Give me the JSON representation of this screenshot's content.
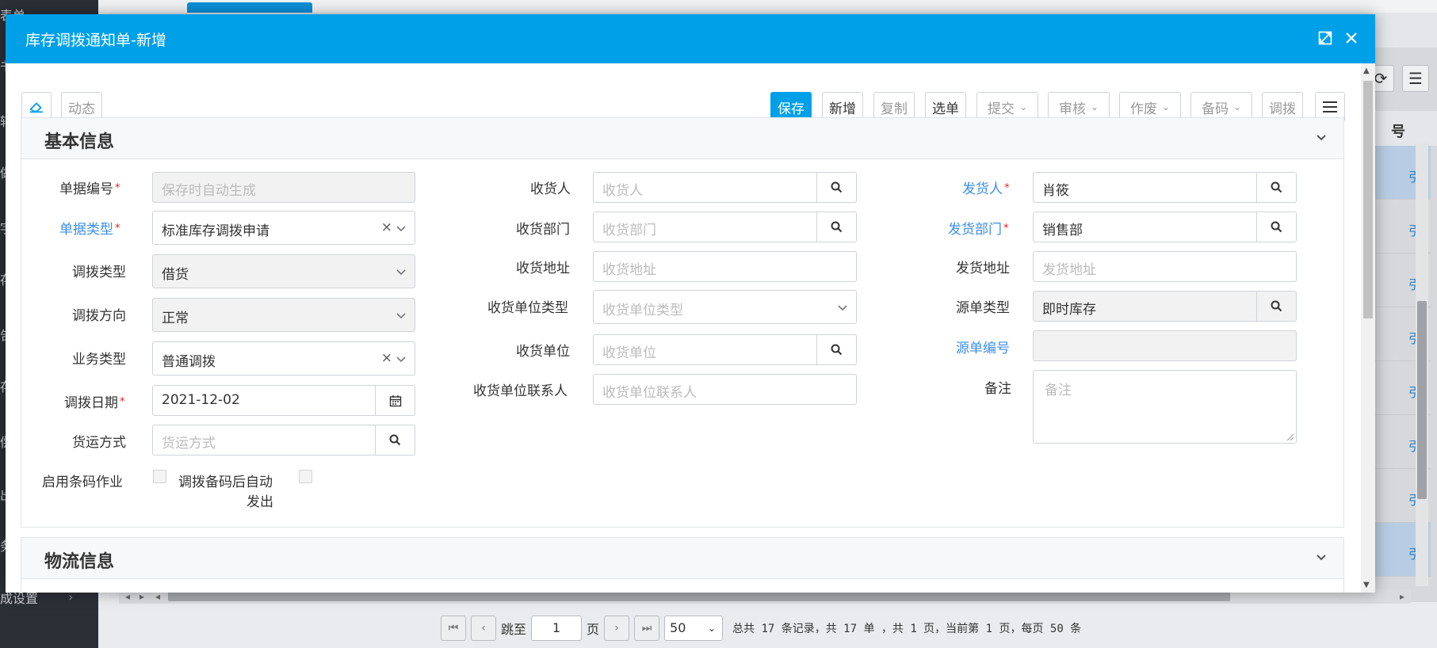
{
  "background": {
    "left_fragments": [
      "表单",
      "书",
      "辅",
      "做",
      "字",
      "存",
      "告",
      "存",
      "偿",
      "出",
      "务"
    ],
    "left_bottom_text": "成设置",
    "right_header": "号",
    "right_row_text": "引",
    "pager": {
      "jump_label": "跳至",
      "page_value": "1",
      "page_unit": "页",
      "page_size": "50",
      "summary": "总共 17 条记录，共 17 单 ，共 1 页，当前第 1 页，每页 50 条"
    }
  },
  "modal": {
    "title": "库存调拨通知单-新增",
    "toolbar": {
      "dynamic": "动态",
      "save": "保存",
      "add": "新增",
      "copy": "复制",
      "select_doc": "选单",
      "submit": "提交",
      "audit": "审核",
      "void": "作废",
      "code": "备码",
      "transfer": "调拨"
    },
    "basic_section": {
      "title": "基本信息",
      "col1": {
        "doc_no_label": "单据编号",
        "doc_no_placeholder": "保存时自动生成",
        "doc_type_label": "单据类型",
        "doc_type_value": "标准库存调拨申请",
        "transfer_type_label": "调拨类型",
        "transfer_type_value": "借货",
        "direction_label": "调拨方向",
        "direction_value": "正常",
        "biz_type_label": "业务类型",
        "biz_type_value": "普通调拨",
        "date_label": "调拨日期",
        "date_value": "2021-12-02",
        "ship_method_label": "货运方式",
        "ship_method_placeholder": "货运方式",
        "barcode_label": "启用条码作业",
        "auto_ship_label_line1": "调拨备码后自动",
        "auto_ship_label_line2": "发出"
      },
      "col2": {
        "receiver_label": "收货人",
        "receiver_placeholder": "收货人",
        "recv_dept_label": "收货部门",
        "recv_dept_placeholder": "收货部门",
        "recv_addr_label": "收货地址",
        "recv_addr_placeholder": "收货地址",
        "recv_unit_type_label": "收货单位类型",
        "recv_unit_type_placeholder": "收货单位类型",
        "recv_unit_label": "收货单位",
        "recv_unit_placeholder": "收货单位",
        "recv_contact_label": "收货单位联系人",
        "recv_contact_placeholder": "收货单位联系人"
      },
      "col3": {
        "shipper_label": "发货人",
        "shipper_value": "肖筱",
        "ship_dept_label": "发货部门",
        "ship_dept_value": "销售部",
        "ship_addr_label": "发货地址",
        "ship_addr_placeholder": "发货地址",
        "source_type_label": "源单类型",
        "source_type_value": "即时库存",
        "source_no_label": "源单编号",
        "remark_label": "备注",
        "remark_placeholder": "备注"
      }
    },
    "logistics_section": {
      "title": "物流信息"
    }
  },
  "colors": {
    "accent": "#00a0e9",
    "required_star": "#e02020",
    "link_label": "#3a8ee6"
  }
}
